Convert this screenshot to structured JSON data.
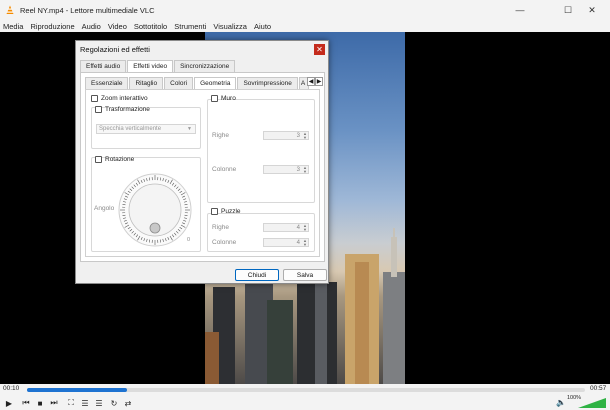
{
  "window": {
    "title": "Reel NY.mp4 - Lettore multimediale VLC"
  },
  "menu": [
    "Media",
    "Riproduzione",
    "Audio",
    "Video",
    "Sottotitolo",
    "Strumenti",
    "Visualizza",
    "Aiuto"
  ],
  "player": {
    "elapsed": "00:10",
    "total": "00:57",
    "progress": 0.18,
    "volume": "100%",
    "volume_level": 1.0
  },
  "dialog": {
    "title": "Regolazioni ed effetti",
    "tabs": [
      "Effetti audio",
      "Effetti video",
      "Sincronizzazione"
    ],
    "selected_tab": 1,
    "subtabs": [
      "Essenziale",
      "Ritaglio",
      "Colori",
      "Geometria",
      "Sovrimpressione",
      "A"
    ],
    "selected_subtab": 3,
    "geometry": {
      "zoom_label": "Zoom interattivo",
      "transform_label": "Trasformazione",
      "transform_value": "Specchia verticalmente",
      "rotation_label": "Rotazione",
      "angle_label": "Angolo",
      "angle_zero": "0",
      "wall_label": "Muro",
      "wall_rows_label": "Righe",
      "wall_rows_value": "3",
      "wall_cols_label": "Colonne",
      "wall_cols_value": "3",
      "puzzle_label": "Puzzle",
      "puzzle_rows_label": "Righe",
      "puzzle_rows_value": "4",
      "puzzle_cols_label": "Colonne",
      "puzzle_cols_value": "4"
    },
    "close_label": "Chiudi",
    "save_label": "Salva"
  },
  "colors": {
    "accent": "#1e73d1",
    "close": "#c42b1c",
    "volume": "#2fb344"
  }
}
